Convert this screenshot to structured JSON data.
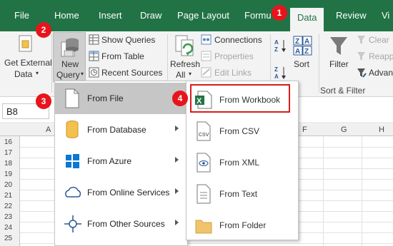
{
  "tabs": [
    {
      "label": "File"
    },
    {
      "label": "Home"
    },
    {
      "label": "Insert"
    },
    {
      "label": "Draw"
    },
    {
      "label": "Page Layout"
    },
    {
      "label": "Formu"
    },
    {
      "label": "Data"
    },
    {
      "label": "Review"
    },
    {
      "label": "Vi"
    }
  ],
  "ribbon": {
    "get_external_line1": "Get External",
    "get_external_line2": "Data",
    "new_query_line1": "New",
    "new_query_line2": "Query",
    "show_queries": "Show Queries",
    "from_table": "From Table",
    "recent_sources": "Recent Sources",
    "refresh_line1": "Refresh",
    "refresh_line2": "All",
    "connections": "Connections",
    "properties": "Properties",
    "edit_links": "Edit Links",
    "sort": "Sort",
    "filter": "Filter",
    "clear": "Clear",
    "reapply": "Reapp",
    "advanced": "Advan",
    "sort_filter_group": "Sort & Filter"
  },
  "namebox": "B8",
  "columns": [
    "A",
    "F",
    "G",
    "H"
  ],
  "rows": [
    "16",
    "17",
    "18",
    "19",
    "20",
    "21",
    "22",
    "23",
    "24",
    "25"
  ],
  "menu1": [
    {
      "label": "From File",
      "icon": "file-icon"
    },
    {
      "label": "From Database",
      "icon": "database-icon"
    },
    {
      "label": "From Azure",
      "icon": "azure-icon"
    },
    {
      "label": "From Online Services",
      "icon": "cloud-icon"
    },
    {
      "label": "From Other Sources",
      "icon": "other-sources-icon"
    }
  ],
  "menu2": [
    {
      "label": "From Workbook",
      "icon": "excel-workbook-icon"
    },
    {
      "label": "From CSV",
      "icon": "csv-icon"
    },
    {
      "label": "From XML",
      "icon": "xml-icon"
    },
    {
      "label": "From Text",
      "icon": "text-file-icon"
    },
    {
      "label": "From Folder",
      "icon": "folder-icon"
    }
  ],
  "badges": [
    "1",
    "2",
    "3",
    "4"
  ],
  "colors": {
    "excel_green": "#217346",
    "badge_red": "#e8141c",
    "highlight_box": "#d81c1c"
  }
}
